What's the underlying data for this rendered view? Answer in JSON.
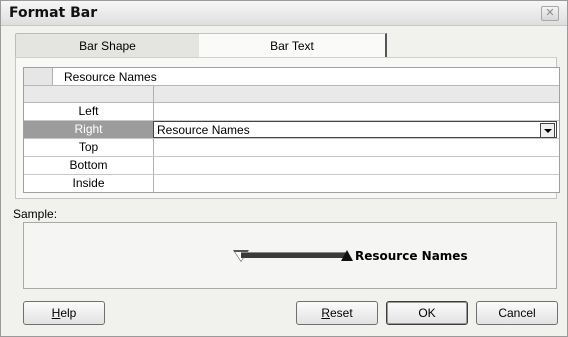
{
  "window": {
    "title": "Format Bar",
    "close_glyph": "✕"
  },
  "tabs": [
    {
      "label": "Bar Shape",
      "active": false
    },
    {
      "label": "Bar Text",
      "active": true
    }
  ],
  "grid": {
    "header_value": "Resource Names",
    "rows": [
      {
        "label": "Left",
        "value": ""
      },
      {
        "label": "Right",
        "value": "Resource Names",
        "selected": true
      },
      {
        "label": "Top",
        "value": ""
      },
      {
        "label": "Bottom",
        "value": ""
      },
      {
        "label": "Inside",
        "value": ""
      }
    ]
  },
  "sample": {
    "label": "Sample:",
    "bar_text": "Resource Names"
  },
  "buttons": {
    "help": {
      "pre": "",
      "accel": "H",
      "post": "elp"
    },
    "reset": {
      "pre": "",
      "accel": "R",
      "post": "eset"
    },
    "ok": "OK",
    "cancel": "Cancel"
  },
  "colors": {
    "selected_row": "#9c9c9c",
    "dialog_bg": "#f1f1ed"
  }
}
